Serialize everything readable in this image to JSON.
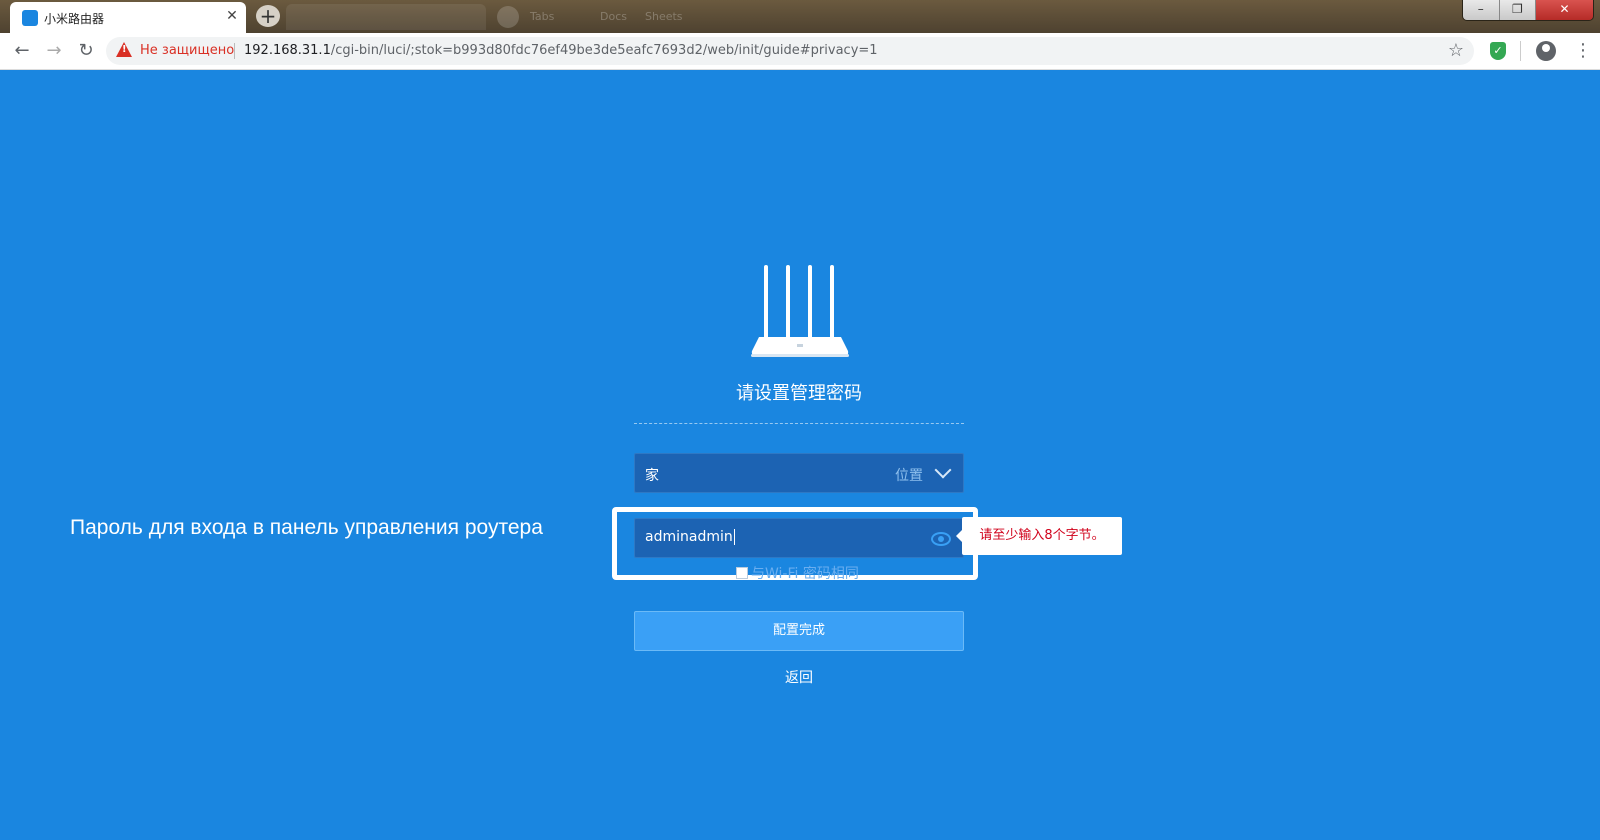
{
  "browser": {
    "active_tab": {
      "title": "小米路由器"
    },
    "background_tabs": [
      "",
      "Tabs",
      "Docs",
      "Sheets"
    ],
    "security_label": "Не защищено",
    "url_host": "192.168.31.1",
    "url_path": "/cgi-bin/luci/;stok=b993d80fdc76ef49be3de5eafc7693d2/web/init/guide#privacy=1",
    "icons": {
      "back": "back-arrow-icon",
      "forward": "forward-arrow-icon",
      "reload": "reload-icon",
      "star": "star-icon",
      "extension": "shield-icon",
      "account": "account-icon",
      "menu": "menu-icon"
    }
  },
  "page": {
    "title": "请设置管理密码",
    "location": {
      "value": "家",
      "label": "位置"
    },
    "password": {
      "value": "adminadmin"
    },
    "error_message": "请至少输入8个字节。",
    "same_as_wifi_label": "与Wi-Fi 密码相同",
    "submit_label": "配置完成",
    "back_label": "返回",
    "annotation": "Пароль для входа в панель управления роутера",
    "colors": {
      "background": "#1a86e0",
      "field": "#1c63b3",
      "button": "#3aa0f6",
      "error": "#d0021b"
    }
  }
}
